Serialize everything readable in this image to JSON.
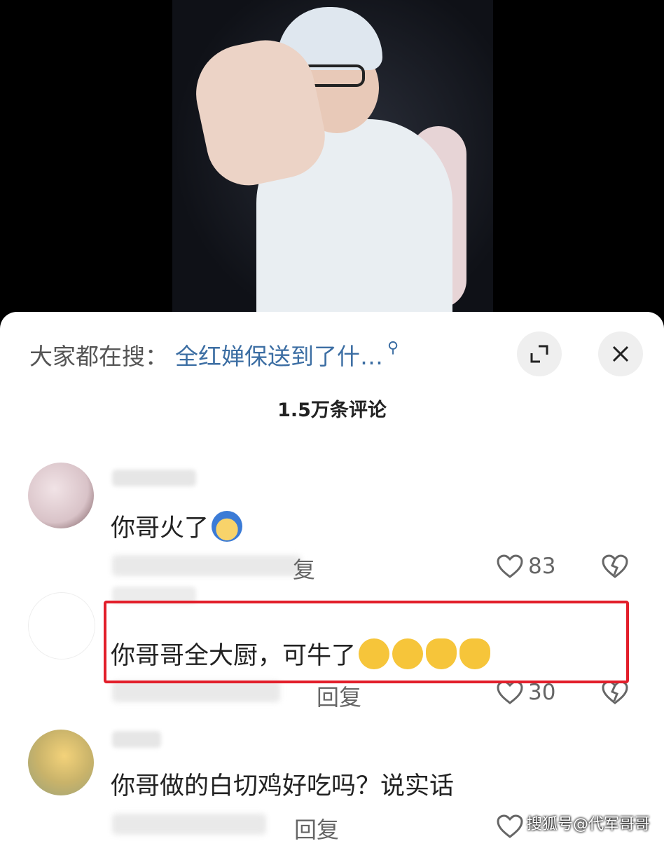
{
  "search": {
    "prefix": "大家都在搜：",
    "query": "全红婵保送到了什…",
    "icon": "search-icon"
  },
  "header": {
    "comment_count": "1.5万条评论",
    "expand_icon": "expand-icon",
    "close_icon": "close-icon"
  },
  "comments": [
    {
      "text": "你哥火了",
      "reply_label": "复",
      "likes": "83",
      "emoji": "blue-hair-face-emoji"
    },
    {
      "text": "你哥哥全大厨，可牛了",
      "reply_label": "回复",
      "likes": "30",
      "emoji": "grinning-face-emoji, finger-heart-emoji"
    },
    {
      "text": "你哥做的白切鸡好吃吗？说实话",
      "reply_label": "回复"
    }
  ],
  "watermark": "搜狐号@代军哥哥",
  "colors": {
    "highlight_border": "#e21e2a",
    "search_link": "#3c6ea3",
    "sheet_bg": "#ffffff"
  }
}
